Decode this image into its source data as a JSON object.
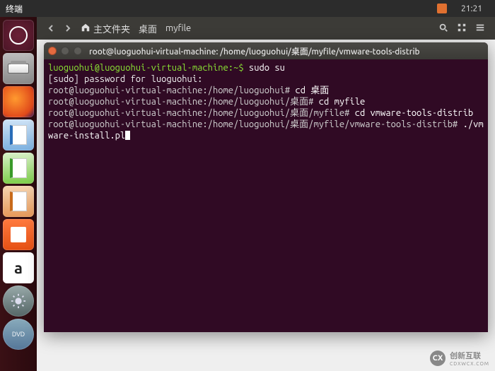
{
  "topbar": {
    "app_name": "终端",
    "time": "21:21"
  },
  "nautilus": {
    "crumb_home": "主文件夹",
    "crumb1": "桌面",
    "crumb2": "myfile"
  },
  "launcher": {
    "items": [
      {
        "name": "ubuntu-dash"
      },
      {
        "name": "files"
      },
      {
        "name": "firefox"
      },
      {
        "name": "libreoffice-writer"
      },
      {
        "name": "libreoffice-calc"
      },
      {
        "name": "libreoffice-impress"
      },
      {
        "name": "ubuntu-software"
      },
      {
        "name": "amazon"
      },
      {
        "name": "system-settings"
      },
      {
        "name": "dvd-media"
      }
    ]
  },
  "terminal": {
    "title": "root@luoguohui-virtual-machine: /home/luoguohui/桌面/myfile/vmware-tools-distrib",
    "lines": [
      {
        "prompt_class": "p-user",
        "prompt": "luoguohui@luoguohui-virtual-machine:~$ ",
        "cmd": "sudo su"
      },
      {
        "prompt_class": "",
        "prompt": "[sudo] password for luoguohui:",
        "cmd": ""
      },
      {
        "prompt_class": "p-root",
        "prompt": "root@luoguohui-virtual-machine:/home/luoguohui# ",
        "cmd": "cd 桌面"
      },
      {
        "prompt_class": "p-root",
        "prompt": "root@luoguohui-virtual-machine:/home/luoguohui/桌面# ",
        "cmd": "cd myfile"
      },
      {
        "prompt_class": "p-root",
        "prompt": "root@luoguohui-virtual-machine:/home/luoguohui/桌面/myfile# ",
        "cmd": "cd vmware-tools-distrib"
      },
      {
        "prompt_class": "p-root",
        "prompt": "root@luoguohui-virtual-machine:/home/luoguohui/桌面/myfile/vmware-tools-distrib# ",
        "cmd": "./vmware-install.pl"
      }
    ]
  },
  "watermark": {
    "badge": "CX",
    "text": "创新互联",
    "sub": "CDXWCX.COM"
  }
}
